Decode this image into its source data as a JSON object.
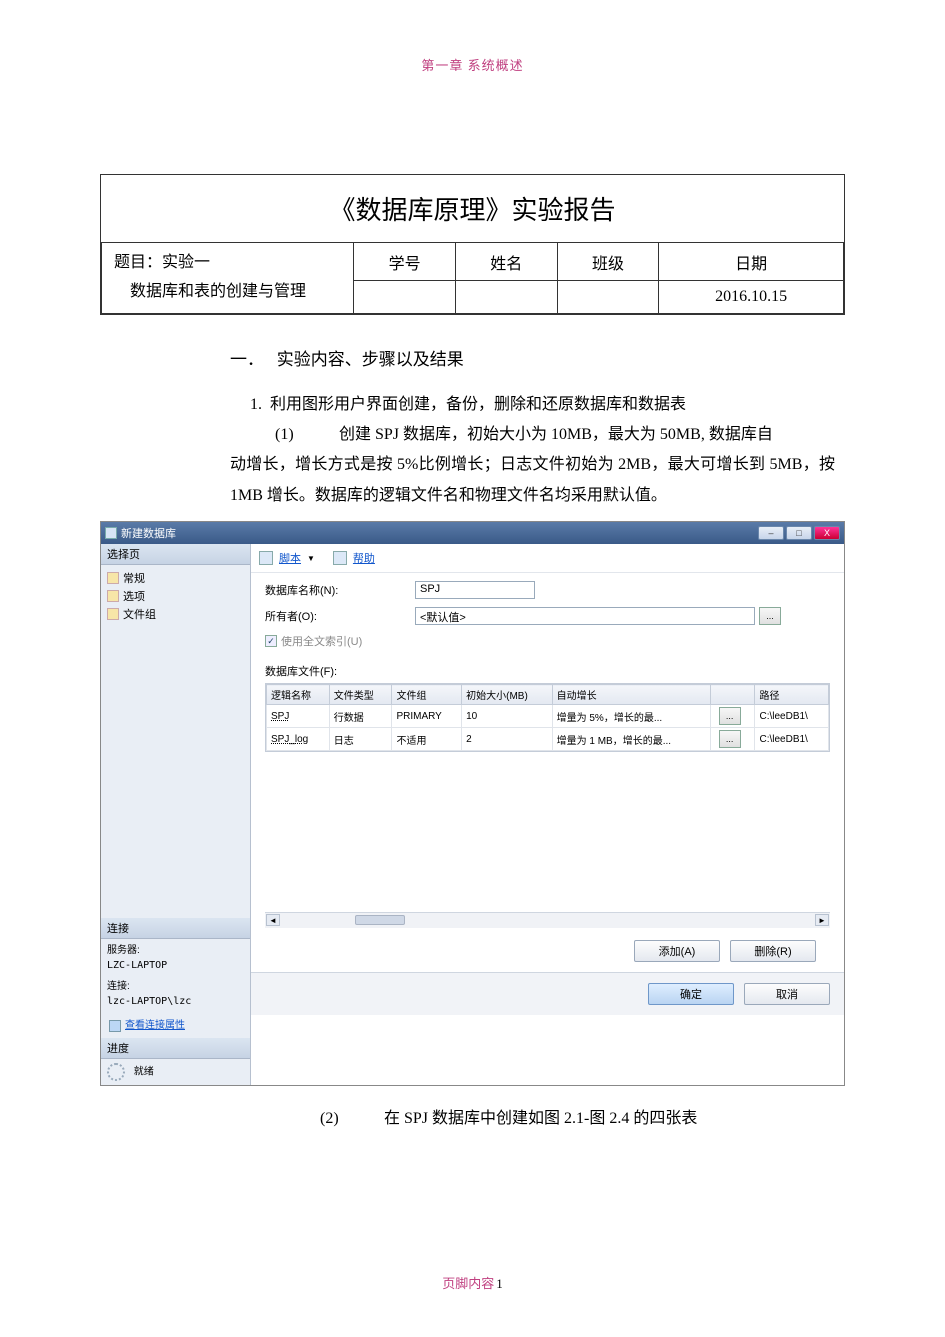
{
  "header_text": "第一章 系统概述",
  "report_title": "《数据库原理》实验报告",
  "info_table": {
    "topic_label": "题目：实验一",
    "topic_line2": "数据库和表的创建与管理",
    "cols": {
      "id": "学号",
      "name": "姓名",
      "class": "班级",
      "date": "日期"
    },
    "vals": {
      "id": "",
      "name": "",
      "class": "",
      "date": "2016.10.15"
    }
  },
  "section1_num": "一．",
  "section1_title": "实验内容、步骤以及结果",
  "item1_num": "1.",
  "item1_text": "利用图形用户界面创建，备份，删除和还原数据库和数据表",
  "sub1_num": "(1)",
  "sub1_text": "创建 SPJ 数据库，初始大小为 10MB，最大为 50MB, 数据库自动增长，增长方式是按 5%比例增长；日志文件初始为 2MB，最大可增长到 5MB，按 1MB 增长。数据库的逻辑文件名和物理文件名均采用默认值。",
  "sub2_num": "(2)",
  "sub2_text": "在 SPJ 数据库中创建如图 2.1-图 2.4 的四张表",
  "screenshot": {
    "window_title": "新建数据库",
    "win_min": "–",
    "win_max": "□",
    "win_close": "X",
    "side_select_hdr": "选择页",
    "side_items": [
      "常规",
      "选项",
      "文件组"
    ],
    "side_conn_hdr": "连接",
    "server_lbl": "服务器:",
    "server_val": "LZC-LAPTOP",
    "conn_lbl": "连接:",
    "conn_val": "lzc-LAPTOP\\lzc",
    "view_conn_link": "查看连接属性",
    "prog_hdr": "进度",
    "prog_text": "就绪",
    "toolbar_script": "脚本",
    "toolbar_sep": "▼",
    "toolbar_help": "帮助",
    "f_dbname_lbl": "数据库名称(N):",
    "f_dbname_val": "SPJ",
    "f_owner_lbl": "所有者(O):",
    "f_owner_val": "<默认值>",
    "f_ft_chk": "使用全文索引(U)",
    "f_files_lbl": "数据库文件(F):",
    "grid_headers": [
      "逻辑名称",
      "文件类型",
      "文件组",
      "初始大小(MB)",
      "自动增长",
      "",
      "路径"
    ],
    "grid_rows": [
      {
        "logical": "SPJ",
        "ftype": "行数据",
        "fgroup": "PRIMARY",
        "init": "10",
        "grow": "增量为 5%，增长的最...",
        "path": "C:\\leeDB1\\"
      },
      {
        "logical": "SPJ_log",
        "ftype": "日志",
        "fgroup": "不适用",
        "init": "2",
        "grow": "增量为 1 MB，增长的最...",
        "path": "C:\\leeDB1\\"
      }
    ],
    "btn_add": "添加(A)",
    "btn_del": "删除(R)",
    "btn_ok": "确定",
    "btn_cancel": "取消",
    "ellipsis": "..."
  },
  "footer_text": "页脚内容",
  "footer_page": "1"
}
